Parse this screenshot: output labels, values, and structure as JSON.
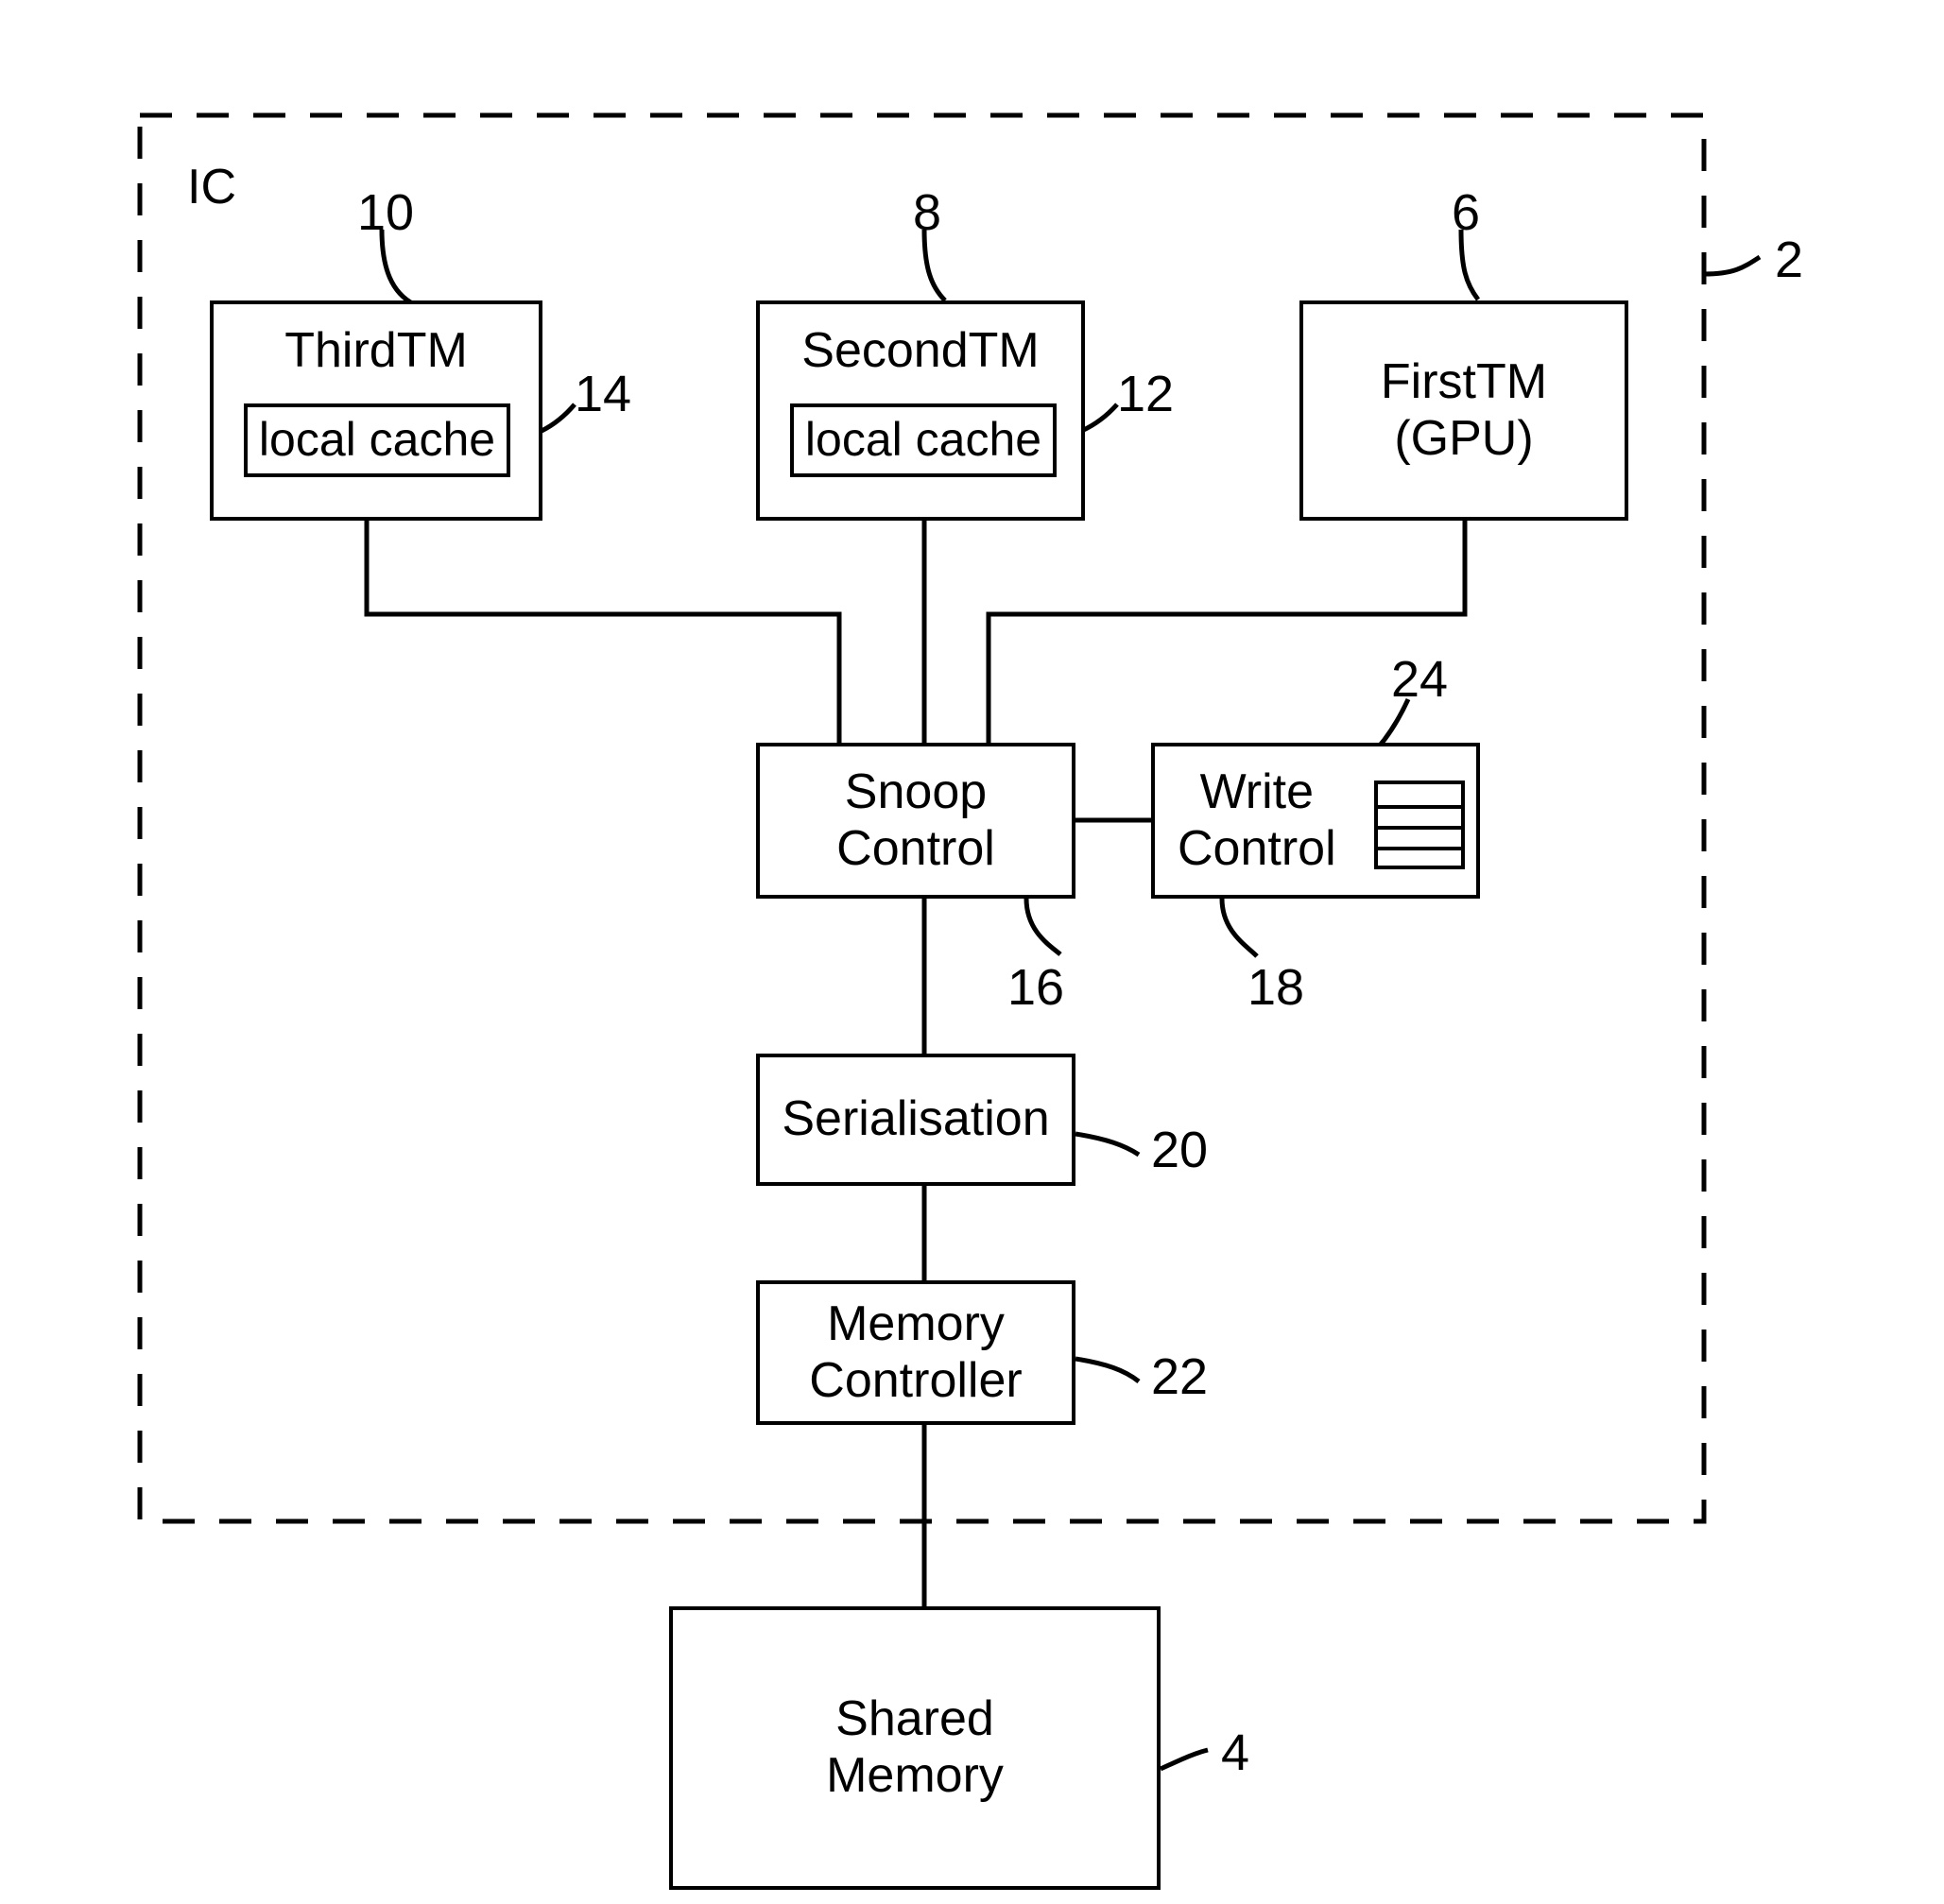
{
  "figure": {
    "ic_label": "IC",
    "ic_ref": "2"
  },
  "blocks": {
    "third_tm": {
      "label": "ThirdTM",
      "ref": "10",
      "inner": {
        "label": "local cache",
        "ref": "14"
      }
    },
    "second_tm": {
      "label": "SecondTM",
      "ref": "8",
      "inner": {
        "label": "local cache",
        "ref": "12"
      }
    },
    "first_tm": {
      "label": "FirstTM\n(GPU)",
      "ref": "6"
    },
    "snoop_control": {
      "label": "Snoop\nControl",
      "ref": "16"
    },
    "write_control": {
      "label": "Write\nControl",
      "ref": "18",
      "buffer_ref": "24"
    },
    "serialisation": {
      "label": "Serialisation",
      "ref": "20"
    },
    "memory_controller": {
      "label": "Memory\nController",
      "ref": "22"
    },
    "shared_memory": {
      "label": "Shared\nMemory",
      "ref": "4"
    }
  },
  "colors": {
    "stroke": "#000000",
    "background": "#ffffff"
  }
}
